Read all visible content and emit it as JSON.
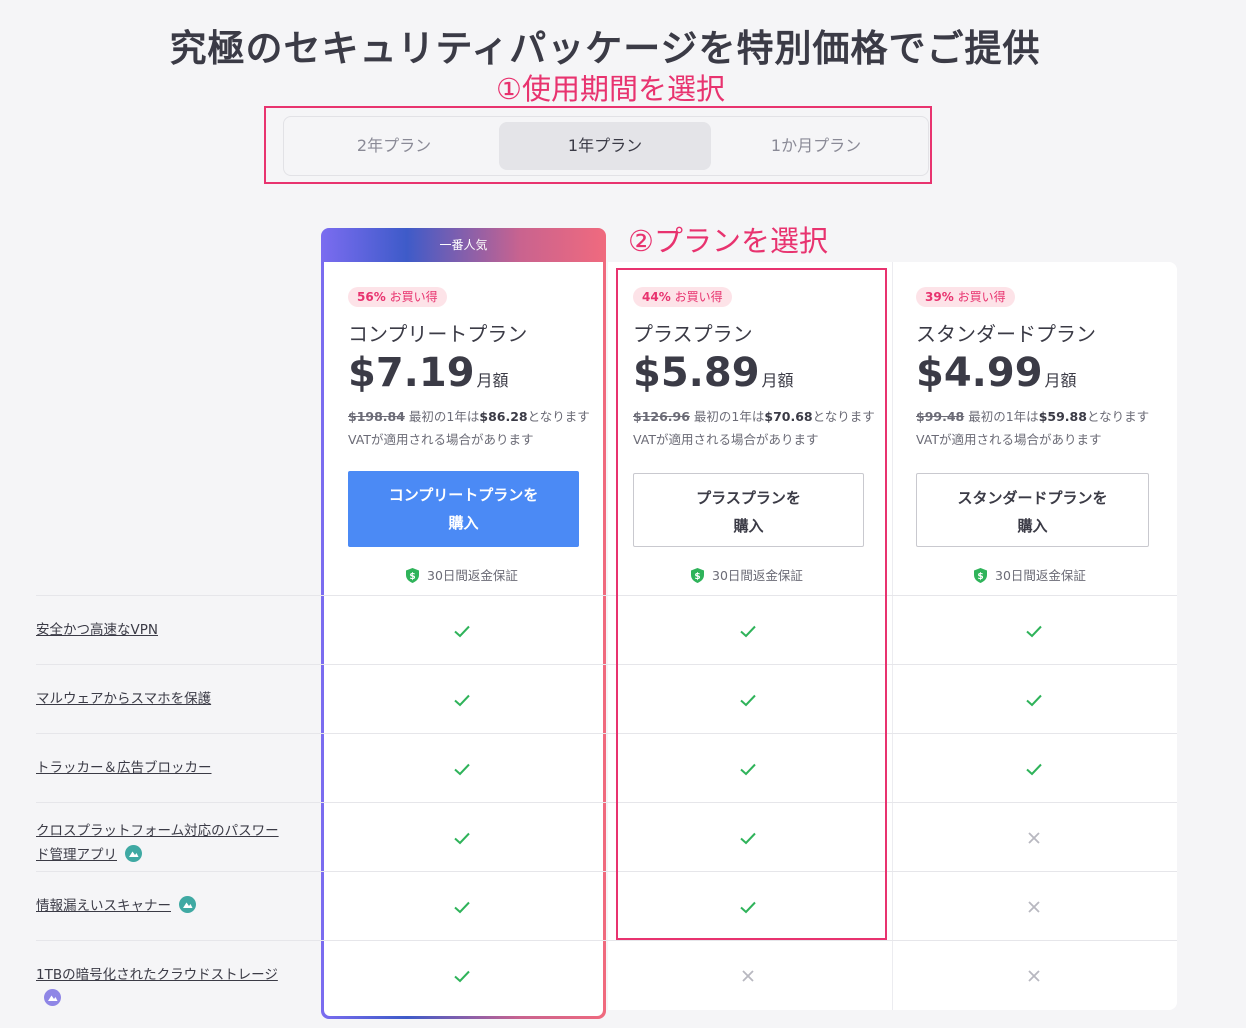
{
  "title": "究極のセキュリティパッケージを特別価格でご提供",
  "annotations": {
    "step1": "①使用期間を選択",
    "step2": "②プランを選択"
  },
  "tabs": [
    {
      "label": "2年プラン",
      "active": false
    },
    {
      "label": "1年プラン",
      "active": true
    },
    {
      "label": "1か月プラン",
      "active": false
    }
  ],
  "popular_label": "一番人気",
  "plans": [
    {
      "discount": "56%",
      "discount_suffix": "お買い得",
      "name": "コンプリートプラン",
      "price": "$7.19",
      "period": "月額",
      "original": "$198.84",
      "first_year_prefix": "最初の1年は",
      "first_year_price": "$86.28",
      "first_year_suffix": "となります",
      "vat": "VATが適用される場合があります",
      "button_line1": "コンプリートプランを",
      "button_line2": "購入",
      "guarantee": "30日間返金保証"
    },
    {
      "discount": "44%",
      "discount_suffix": "お買い得",
      "name": "プラスプラン",
      "price": "$5.89",
      "period": "月額",
      "original": "$126.96",
      "first_year_prefix": "最初の1年は",
      "first_year_price": "$70.68",
      "first_year_suffix": "となります",
      "vat": "VATが適用される場合があります",
      "button_line1": "プラスプランを",
      "button_line2": "購入",
      "guarantee": "30日間返金保証"
    },
    {
      "discount": "39%",
      "discount_suffix": "お買い得",
      "name": "スタンダードプラン",
      "price": "$4.99",
      "period": "月額",
      "original": "$99.48",
      "first_year_prefix": "最初の1年は",
      "first_year_price": "$59.88",
      "first_year_suffix": "となります",
      "vat": "VATが適用される場合があります",
      "button_line1": "スタンダードプランを",
      "button_line2": "購入",
      "guarantee": "30日間返金保証"
    }
  ],
  "features": [
    {
      "line1": "安全かつ高速なVPN",
      "line2": "",
      "info_icon": "",
      "included": [
        true,
        true,
        true
      ]
    },
    {
      "line1": "マルウェアからスマホを保護",
      "line2": "",
      "info_icon": "",
      "included": [
        true,
        true,
        true
      ]
    },
    {
      "line1": "トラッカー＆広告ブロッカー",
      "line2": "",
      "info_icon": "",
      "included": [
        true,
        true,
        true
      ]
    },
    {
      "line1": "クロスプラットフォーム対応のパスワー",
      "line2": "ド管理アプリ",
      "info_icon": "teal-mountain-icon",
      "included": [
        true,
        true,
        false
      ]
    },
    {
      "line1": "情報漏えいスキャナー",
      "line2": "",
      "info_icon": "teal-mountain-icon",
      "included": [
        true,
        true,
        false
      ]
    },
    {
      "line1": "1TBの暗号化されたクラウドストレージ",
      "line2": "",
      "info_icon": "purple-cloud-icon",
      "included": [
        true,
        false,
        false
      ]
    }
  ],
  "colors": {
    "accent_red": "#e8336f",
    "primary_blue": "#4b8af5",
    "check_green": "#2fb35a",
    "cross_gray": "#b8b8c0"
  }
}
